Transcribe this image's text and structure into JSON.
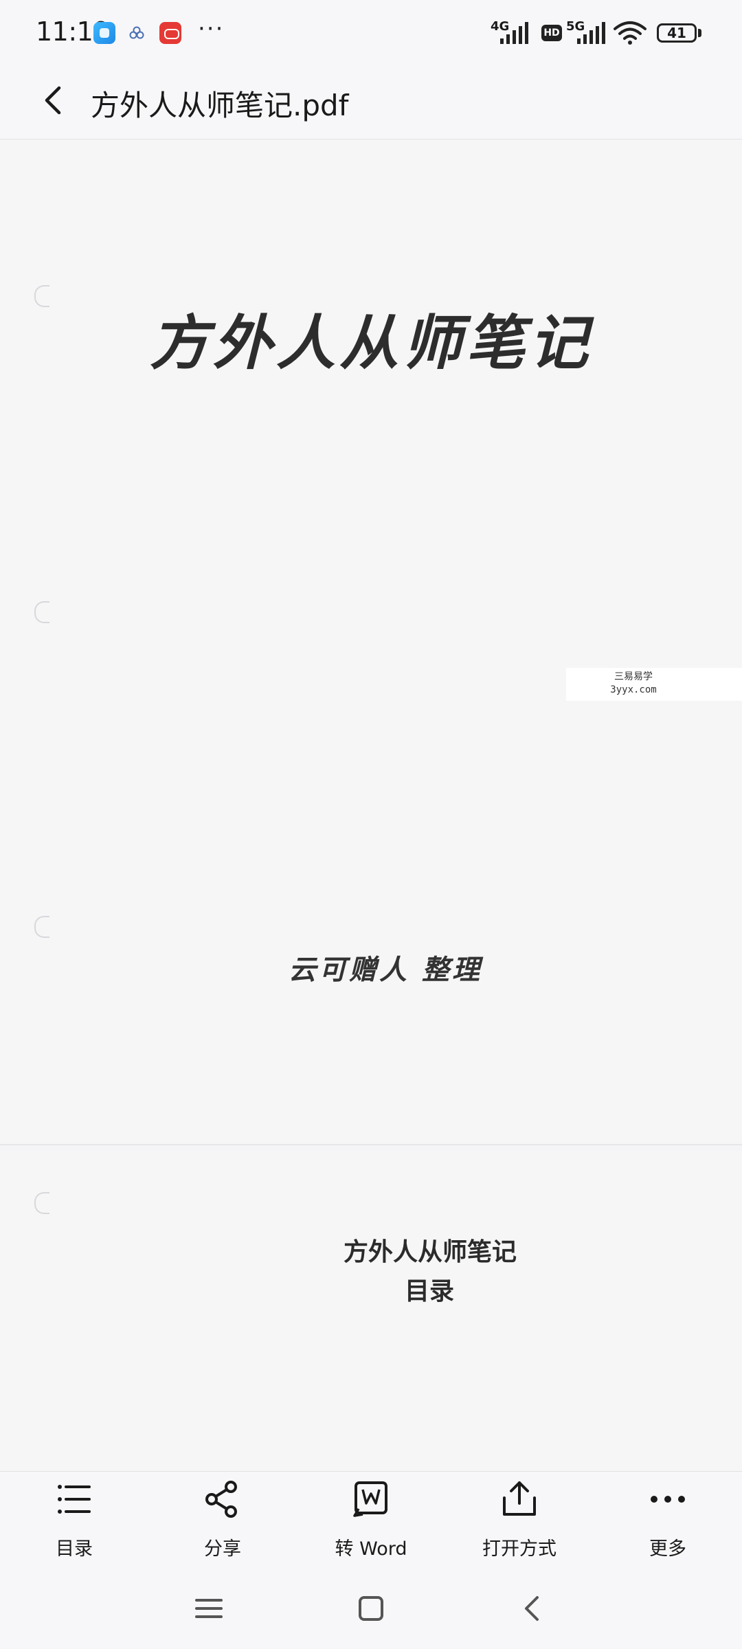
{
  "status_bar": {
    "time": "11:19",
    "network_1": "4G",
    "hd_badge": "HD",
    "network_2": "5G",
    "battery": "41"
  },
  "header": {
    "back_icon": "chevron-left-icon",
    "title": "方外人从师笔记.pdf"
  },
  "document": {
    "page1": {
      "title": "方外人从师笔记",
      "author": "云可赠人 整理",
      "watermark_line1": "三易易学",
      "watermark_line2": "3yyx.com"
    },
    "page2": {
      "title": "方外人从师笔记",
      "subtitle": "目录"
    }
  },
  "toolbar": {
    "items": [
      {
        "label": "目录",
        "icon": "list-icon"
      },
      {
        "label": "分享",
        "icon": "share-icon"
      },
      {
        "label": "转 Word",
        "icon": "word-convert-icon"
      },
      {
        "label": "打开方式",
        "icon": "upload-open-icon"
      },
      {
        "label": "更多",
        "icon": "more-icon"
      }
    ]
  },
  "nav_bar": {
    "items": [
      "menu-icon",
      "home-icon",
      "back-icon"
    ]
  }
}
